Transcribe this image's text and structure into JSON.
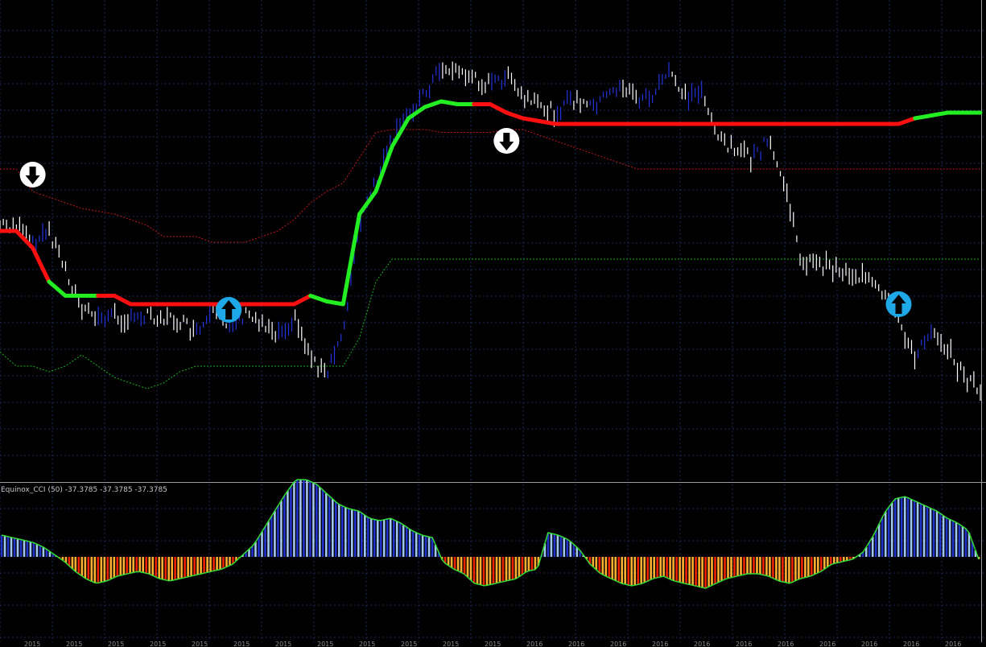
{
  "chart_data": [
    {
      "type": "line",
      "panel": "price",
      "x": [
        0,
        1,
        2,
        3,
        4,
        5,
        6,
        7,
        8,
        9,
        10,
        11,
        12,
        13,
        14,
        15,
        16,
        17,
        18,
        19,
        20,
        21,
        22,
        23,
        24,
        25,
        26,
        27,
        28,
        29,
        30,
        31,
        32,
        33,
        34,
        35,
        36,
        37,
        38,
        39,
        40,
        41,
        42,
        43,
        44,
        45,
        46,
        47,
        48,
        49,
        50,
        51,
        52,
        53,
        54,
        55,
        56,
        57,
        58,
        59,
        60
      ],
      "series": [
        {
          "role": "price_close",
          "color": "#e6e6e6",
          "values": [
            100,
            100,
            107,
            102,
            115,
            130,
            133,
            132,
            134,
            131,
            133,
            134,
            139,
            132,
            135,
            132,
            134,
            138,
            133,
            146,
            154,
            137,
            100,
            85,
            70,
            60,
            53,
            44,
            45,
            48,
            50,
            47,
            55,
            58,
            60,
            55,
            58,
            55,
            50,
            55,
            54,
            45,
            55,
            52,
            70,
            72,
            77,
            70,
            85,
            112,
            114,
            115,
            117,
            119,
            125,
            133,
            148,
            136,
            144,
            154,
            158
          ]
        },
        {
          "role": "trend_line",
          "color_up": "#22ee22",
          "color_down": "#ff1010",
          "values": [
            102,
            102,
            108,
            120,
            125,
            125,
            125,
            125,
            128,
            128,
            128,
            128,
            128,
            128,
            128,
            128,
            128,
            128,
            128,
            125,
            127,
            128,
            96,
            88,
            72,
            62,
            58,
            56,
            57,
            57,
            57,
            60,
            62,
            63,
            64,
            64,
            64,
            64,
            64,
            64,
            64,
            64,
            64,
            64,
            64,
            64,
            64,
            64,
            64,
            64,
            64,
            64,
            64,
            64,
            64,
            64,
            62,
            61,
            60,
            60,
            60
          ]
        },
        {
          "role": "upper_band",
          "color": "#ff2020",
          "values": [
            80,
            80,
            88,
            90,
            92,
            94,
            95,
            96,
            98,
            100,
            104,
            104,
            104,
            106,
            106,
            106,
            104,
            102,
            98,
            92,
            88,
            85,
            76,
            67,
            66,
            66,
            66,
            67,
            67,
            67,
            67,
            66,
            66,
            68,
            70,
            72,
            74,
            76,
            78,
            80,
            80,
            80,
            80,
            80,
            80,
            80,
            80,
            80,
            80,
            80,
            80,
            80,
            80,
            80,
            80,
            80,
            80,
            80,
            80,
            80,
            80
          ]
        },
        {
          "role": "lower_band",
          "color": "#22ee22",
          "values": [
            145,
            150,
            150,
            152,
            150,
            146,
            150,
            154,
            156,
            158,
            156,
            152,
            150,
            150,
            150,
            150,
            150,
            150,
            150,
            150,
            150,
            150,
            140,
            120,
            112,
            112,
            112,
            112,
            112,
            112,
            112,
            112,
            112,
            112,
            112,
            112,
            112,
            112,
            112,
            112,
            112,
            112,
            112,
            112,
            112,
            112,
            112,
            112,
            112,
            112,
            112,
            112,
            112,
            112,
            112,
            112,
            112,
            112,
            112,
            112,
            112
          ]
        }
      ],
      "signals": [
        {
          "kind": "sell-arrow",
          "x": 2,
          "y": 82
        },
        {
          "kind": "buy-arrow",
          "x": 14,
          "y": 130
        },
        {
          "kind": "sell-arrow",
          "x": 31,
          "y": 70
        },
        {
          "kind": "buy-arrow",
          "x": 55,
          "y": 128
        }
      ],
      "grid": true
    },
    {
      "type": "bar",
      "panel": "indicator",
      "title": "Equinox_CCI (50) -37.3785 -37.3785 -37.3785",
      "x_count": 305,
      "values_note": "",
      "values": [
        45,
        40,
        35,
        30,
        20,
        5,
        -10,
        -30,
        -45,
        -55,
        -50,
        -40,
        -35,
        -30,
        -35,
        -45,
        -50,
        -45,
        -40,
        -35,
        -30,
        -25,
        -15,
        5,
        25,
        60,
        95,
        130,
        160,
        160,
        150,
        130,
        110,
        100,
        95,
        80,
        75,
        80,
        70,
        55,
        45,
        40,
        -10,
        -25,
        -35,
        -55,
        -60,
        -55,
        -50,
        -45,
        -30,
        -25,
        50,
        45,
        35,
        15,
        -15,
        -35,
        -45,
        -55,
        -60,
        -55,
        -45,
        -40,
        -50,
        -55,
        -60,
        -65,
        -55,
        -45,
        -40,
        -35,
        -35,
        -40,
        -50,
        -55,
        -45,
        -40,
        -30,
        -15,
        -10,
        -5,
        10,
        45,
        90,
        120,
        125,
        115,
        105,
        95,
        80,
        70,
        55,
        -5
      ]
    }
  ],
  "colors": {
    "background": "#000000",
    "grid": "#1a2a5a",
    "price_up": "#2233dd",
    "price_down": "#ffffff",
    "trend_up": "#22ee22",
    "trend_down": "#ff1010",
    "cci_pos_dark": "#2233cc",
    "cci_pos_light": "#a0c8ee",
    "cci_neg_dark": "#ee2200",
    "cci_neg_light": "#ffb030",
    "cci_outline": "#33dd33"
  },
  "x_tick_labels": [
    "2015",
    "2015",
    "2015",
    "2015",
    "2015",
    "2015",
    "2015",
    "2015",
    "2015",
    "2015",
    "2015",
    "2015",
    "2016",
    "2016",
    "2016",
    "2016",
    "2016",
    "2016",
    "2016",
    "2016",
    "2016",
    "2016",
    "2016"
  ]
}
